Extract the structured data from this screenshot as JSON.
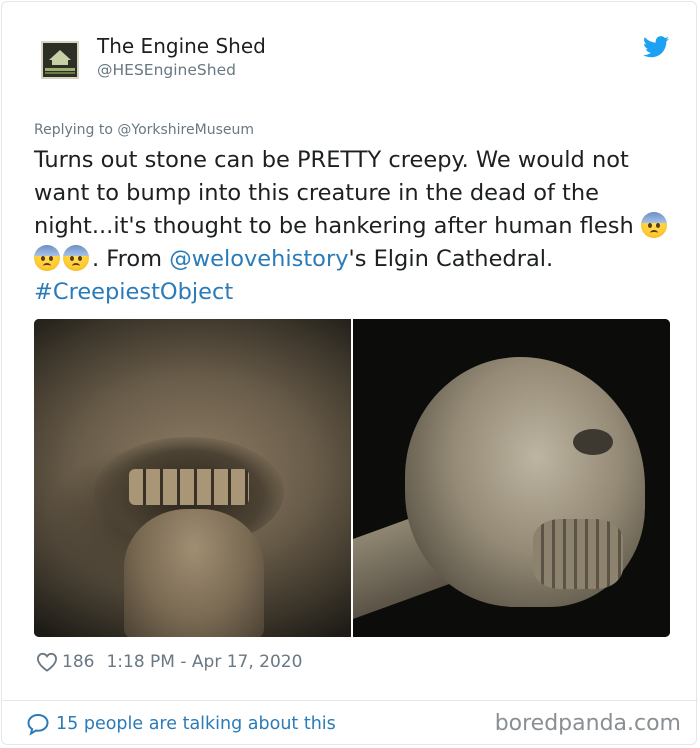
{
  "tweet": {
    "author_name": "The Engine Shed",
    "author_handle": "@HESEngineShed",
    "replying_to": "Replying to @YorkshireMuseum",
    "text_part1": "Turns out stone can be PRETTY creepy. We would not want to bump into this creature in the dead of the night...it's thought to be hankering after human flesh ",
    "text_part2": ". From ",
    "mention": "@welovehistory",
    "text_part3": "'s Elgin Cathedral. ",
    "hashtag": "#CreepiestObject",
    "emoji_icons": [
      "anxious-face-icon",
      "anxious-face-icon",
      "anxious-face-icon"
    ],
    "likes": "186",
    "timestamp": "1:18 PM - Apr 17, 2020",
    "talking": "15 people are talking about this"
  },
  "watermark": "boredpanda.com",
  "colors": {
    "link": "#2b7bb9",
    "secondary_text": "#697882",
    "twitter_blue": "#1da1f2"
  }
}
